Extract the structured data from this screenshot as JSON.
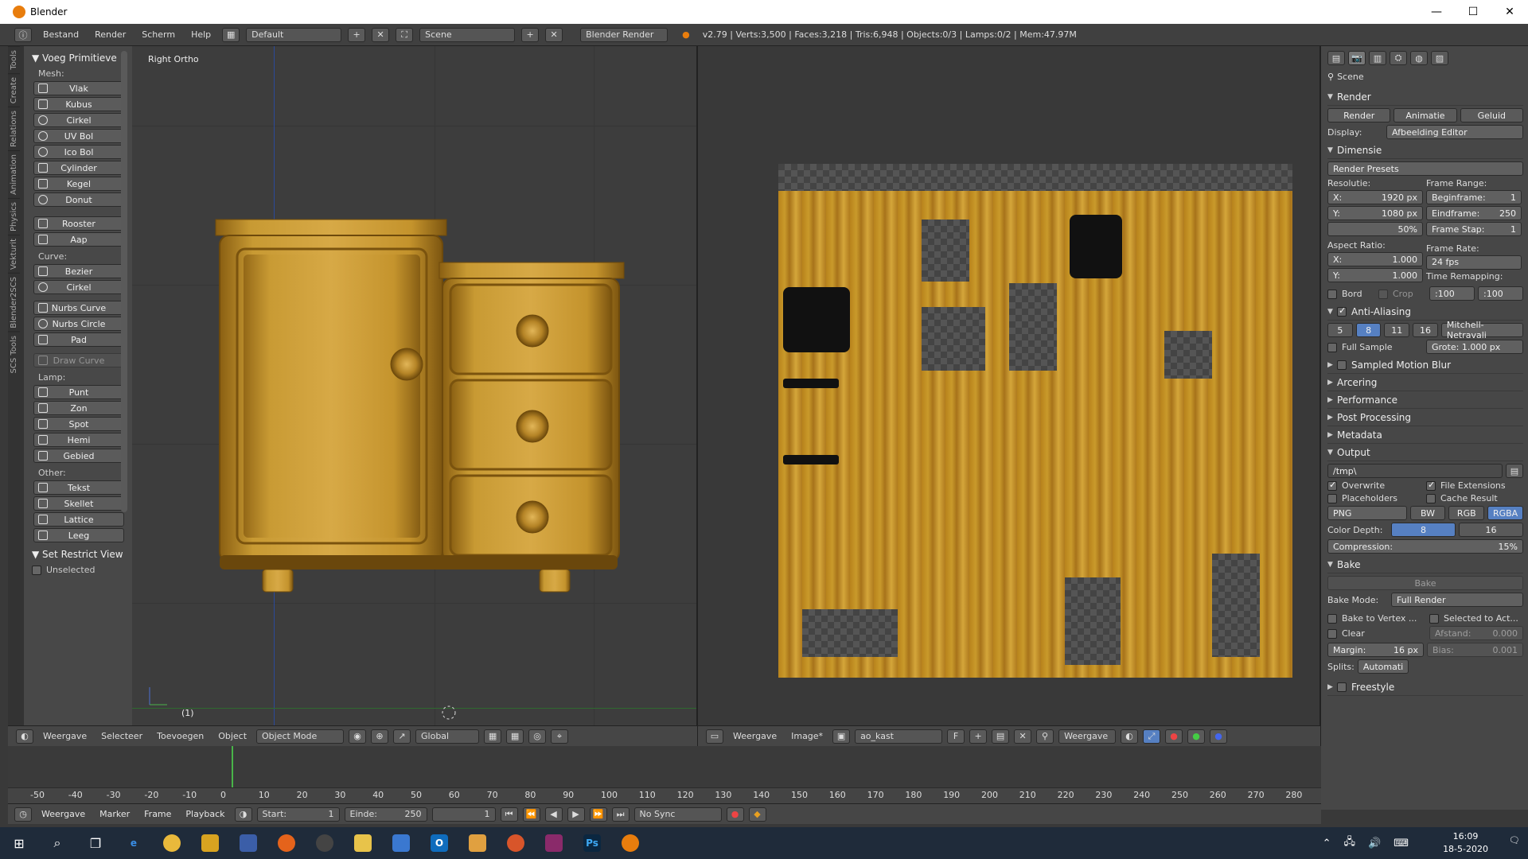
{
  "window": {
    "title": "Blender",
    "min": "—",
    "max": "☐",
    "close": "✕"
  },
  "info": {
    "menus": [
      "Bestand",
      "Render",
      "Scherm",
      "Help"
    ],
    "layout": "Default",
    "scene": "Scene",
    "engine": "Blender Render",
    "stats": "v2.79 | Verts:3,500 | Faces:3,218 | Tris:6,948 | Objects:0/3 | Lamps:0/2 | Mem:47.97M"
  },
  "tabs": [
    "Tools",
    "Create",
    "Relations",
    "Animation",
    "Physics",
    "Vekturit",
    "Blender2SCS",
    "SCS Tools"
  ],
  "shelf": {
    "title": "Voeg Primitieve",
    "mesh_label": "Mesh:",
    "mesh": [
      "Vlak",
      "Kubus",
      "Cirkel",
      "UV Bol",
      "Ico Bol",
      "Cylinder",
      "Kegel",
      "Donut"
    ],
    "extra": [
      "Rooster",
      "Aap"
    ],
    "curve_label": "Curve:",
    "curve": [
      "Bezier",
      "Cirkel"
    ],
    "nurbs": [
      "Nurbs Curve",
      "Nurbs Circle",
      "Pad"
    ],
    "draw_curve": "Draw Curve",
    "lamp_label": "Lamp:",
    "lamp": [
      "Punt",
      "Zon",
      "Spot",
      "Hemi",
      "Gebied"
    ],
    "other_label": "Other:",
    "other": [
      "Tekst",
      "Skellet",
      "Lattice",
      "Leeg"
    ],
    "restrict_title": "Set Restrict View",
    "unselected": "Unselected"
  },
  "view3d": {
    "label": "Right Ortho",
    "frame": "(1)"
  },
  "view3d_header": {
    "menus": [
      "Weergave",
      "Selecteer",
      "Toevoegen",
      "Object"
    ],
    "mode": "Object Mode",
    "orientation": "Global"
  },
  "image_header": {
    "menus": [
      "Weergave",
      "Image*"
    ],
    "image": "ao_kast",
    "f": "F",
    "view": "Weergave"
  },
  "timeline": {
    "ticks": [
      "-50",
      "-40",
      "-30",
      "-20",
      "-10",
      "0",
      "10",
      "20",
      "30",
      "40",
      "50",
      "60",
      "70",
      "80",
      "90",
      "100",
      "110",
      "120",
      "130",
      "140",
      "150",
      "160",
      "170",
      "180",
      "190",
      "200",
      "210",
      "220",
      "230",
      "240",
      "250",
      "260",
      "270",
      "280"
    ],
    "menus": [
      "Weergave",
      "Marker",
      "Frame",
      "Playback"
    ],
    "start_label": "Start:",
    "start": "1",
    "end_label": "Einde:",
    "end": "250",
    "current": "1",
    "sync": "No Sync"
  },
  "props": {
    "scene": "Scene",
    "render_title": "Render",
    "render_btn": "Render",
    "anim_btn": "Animatie",
    "sound_btn": "Geluid",
    "display_label": "Display:",
    "display": "Afbeelding Editor",
    "dim_title": "Dimensie",
    "presets": "Render Presets",
    "res_label": "Resolutie:",
    "res_x": "1920 px",
    "res_y": "1080 px",
    "res_pct": "50%",
    "fr_label": "Frame Range:",
    "fr_start": "Beginframe:",
    "fr_start_v": "1",
    "fr_end": "Eindframe:",
    "fr_end_v": "250",
    "fr_step": "Frame Stap:",
    "fr_step_v": "1",
    "asp_label": "Aspect Ratio:",
    "asp_x": "1.000",
    "asp_y": "1.000",
    "rate_label": "Frame Rate:",
    "fps": "24 fps",
    "bord": "Bord",
    "crop": "Crop",
    "remap_label": "Time Remapping:",
    "remap_old": ":100",
    "remap_new": ":100",
    "aa_title": "Anti-Aliasing",
    "aa": [
      "5",
      "8",
      "11",
      "16"
    ],
    "aa_filter": "Mitchell-Netravali",
    "full_sample": "Full Sample",
    "size": "Grote: 1.000 px",
    "smb": "Sampled Motion Blur",
    "shading": "Arcering",
    "performance": "Performance",
    "post": "Post Processing",
    "metadata": "Metadata",
    "output_title": "Output",
    "path": "/tmp\\",
    "overwrite": "Overwrite",
    "file_ext": "File Extensions",
    "placeholders": "Placeholders",
    "cache": "Cache Result",
    "format": "PNG",
    "bw": "BW",
    "rgb": "RGB",
    "rgba": "RGBA",
    "depth_label": "Color Depth:",
    "d8": "8",
    "d16": "16",
    "compression": "Compression:",
    "comp_v": "15%",
    "bake_title": "Bake",
    "bake_btn": "Bake",
    "bake_mode_label": "Bake Mode:",
    "bake_mode": "Full Render",
    "bake_vertex": "Bake to Vertex ...",
    "sel_active": "Selected to Act...",
    "clear": "Clear",
    "afstand": "Afstand:",
    "afstand_v": "0.000",
    "margin": "Margin:",
    "margin_v": "16 px",
    "bias": "Bias:",
    "bias_v": "0.001",
    "splits": "Splits:",
    "splits_v": "Automati",
    "freestyle": "Freestyle",
    "x": "X:",
    "y": "Y:"
  },
  "clock": {
    "time": "16:09",
    "date": "18-5-2020"
  },
  "colors": {
    "accent": "#5680c2",
    "timeline_cursor": "#49b449",
    "wood": "#c99a2b"
  }
}
